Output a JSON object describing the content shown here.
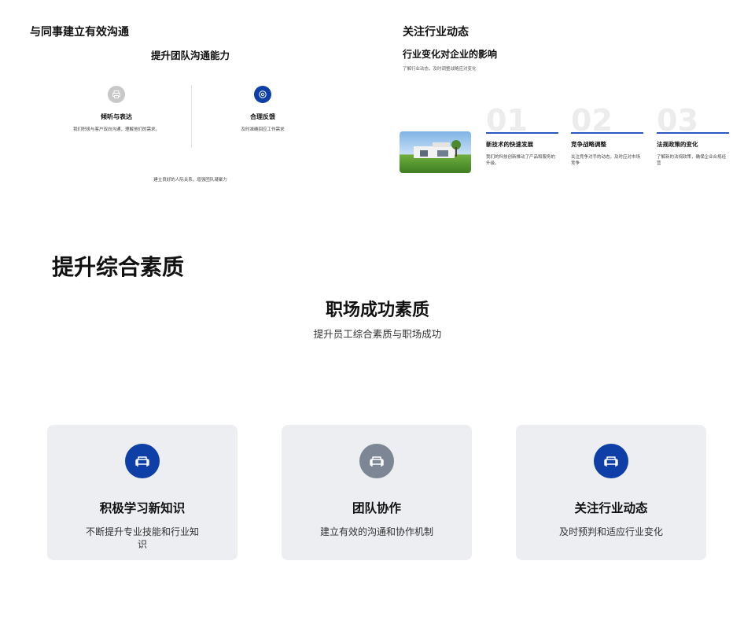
{
  "top_left": {
    "title": "与同事建立有效沟通",
    "subtitle": "提升团队沟通能力",
    "features": [
      {
        "icon": "printer-icon",
        "title": "倾听与表达",
        "desc": "我们积极与客户双向沟通，理解他们的需求。",
        "icon_color": "#c8c8c8"
      },
      {
        "icon": "target-icon",
        "title": "合理反馈",
        "desc": "及时准确回应工作需求",
        "icon_color": "#0d3fa6"
      }
    ],
    "footer": "建立良好的人际关系，增强团队凝聚力"
  },
  "top_right": {
    "title": "关注行业动态",
    "subtitle": "行业变化对企业的影响",
    "desc": "了解行业动态，及时调整战略应对变化",
    "columns": [
      {
        "num": "01",
        "title": "新技术的快速发展",
        "desc": "我们的科技创新推动了产品和服务的升级。"
      },
      {
        "num": "02",
        "title": "竞争战略调整",
        "desc": "关注竞争对手的动态，及时应对市场竞争"
      },
      {
        "num": "03",
        "title": "法规政策的变化",
        "desc": "了解新的法规政策，确保企业合规经营"
      }
    ]
  },
  "bottom": {
    "title": "提升综合素质",
    "subtitle": "职场成功素质",
    "desc": "提升员工综合素质与职场成功",
    "cards": [
      {
        "icon": "sofa-icon",
        "icon_color": "#0d3fa6",
        "title": "积极学习新知识",
        "desc": "不断提升专业技能和行业知识"
      },
      {
        "icon": "sofa-icon",
        "icon_color": "#7d8694",
        "title": "团队协作",
        "desc": "建立有效的沟通和协作机制"
      },
      {
        "icon": "sofa-icon",
        "icon_color": "#0d3fa6",
        "title": "关注行业动态",
        "desc": "及时预判和适应行业变化"
      }
    ]
  },
  "colors": {
    "accent": "#0d3fa6",
    "muted_icon": "#7d8694",
    "card_bg": "#eceef2",
    "rule": "#2b59c3"
  }
}
